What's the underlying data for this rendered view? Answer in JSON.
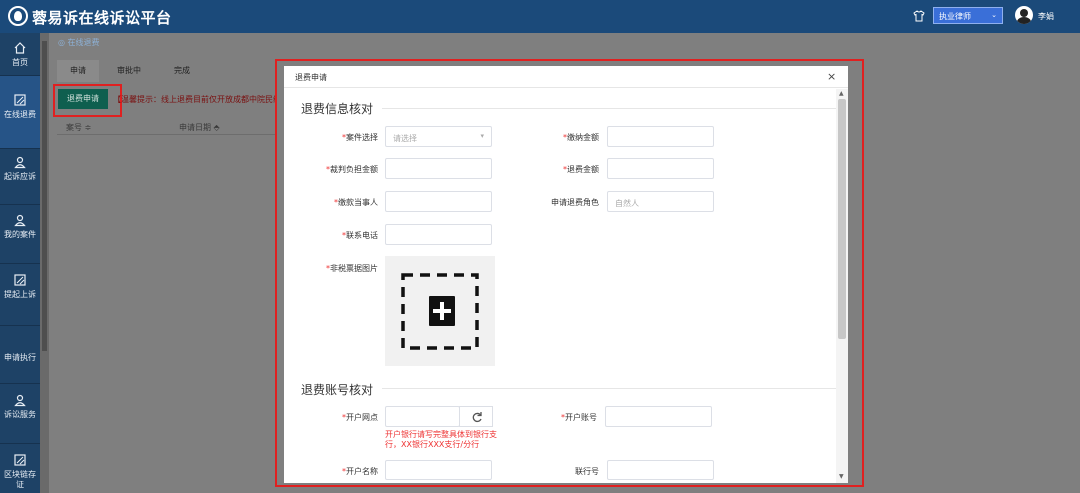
{
  "header": {
    "title": "蓉易诉在线诉讼平台",
    "role_select": "执业律师",
    "username": "李娟"
  },
  "sidebar": {
    "items": [
      {
        "label": "首页",
        "icon": "home-icon"
      },
      {
        "label": "在线退费",
        "icon": "document-icon"
      },
      {
        "label": "起诉应诉",
        "icon": "user-icon"
      },
      {
        "label": "我的案件",
        "icon": "user-icon"
      },
      {
        "label": "提起上诉",
        "icon": "document-icon"
      },
      {
        "label": "申请执行",
        "icon": ""
      },
      {
        "label": "诉讼服务",
        "icon": "user-icon"
      },
      {
        "label": "区块链存证",
        "icon": "document-icon"
      }
    ]
  },
  "page": {
    "breadcrumb": "在线退费",
    "tabs": [
      "申请",
      "审批中",
      "完成"
    ],
    "refund_button": "退费申请",
    "notice": "【温馨提示：线上退费目前仅开放成都中院民终以",
    "columns": [
      "案号",
      "申请日期"
    ]
  },
  "modal": {
    "title": "退费申请",
    "close": "×",
    "section1": "退费信息核对",
    "section2": "退费账号核对",
    "fields": {
      "case_select": {
        "label": "案件选择",
        "placeholder": "请选择"
      },
      "paid_amount": {
        "label": "缴纳金额"
      },
      "judged_amount": {
        "label": "裁判负担金额"
      },
      "refund_amount": {
        "label": "退费金额"
      },
      "payer": {
        "label": "缴款当事人"
      },
      "refund_role": {
        "label": "申请退费角色",
        "value": "自然人"
      },
      "phone": {
        "label": "联系电话"
      },
      "receipt_image": {
        "label": "非税票据图片"
      },
      "bank_branch": {
        "label": "开户网点"
      },
      "bank_account": {
        "label": "开户账号"
      },
      "bank_hint": "开户银行请写完整具体到银行支行，XX银行XXX支行/分行",
      "account_name": {
        "label": "开户名称"
      },
      "bank_code": {
        "label": "联行号"
      }
    }
  }
}
